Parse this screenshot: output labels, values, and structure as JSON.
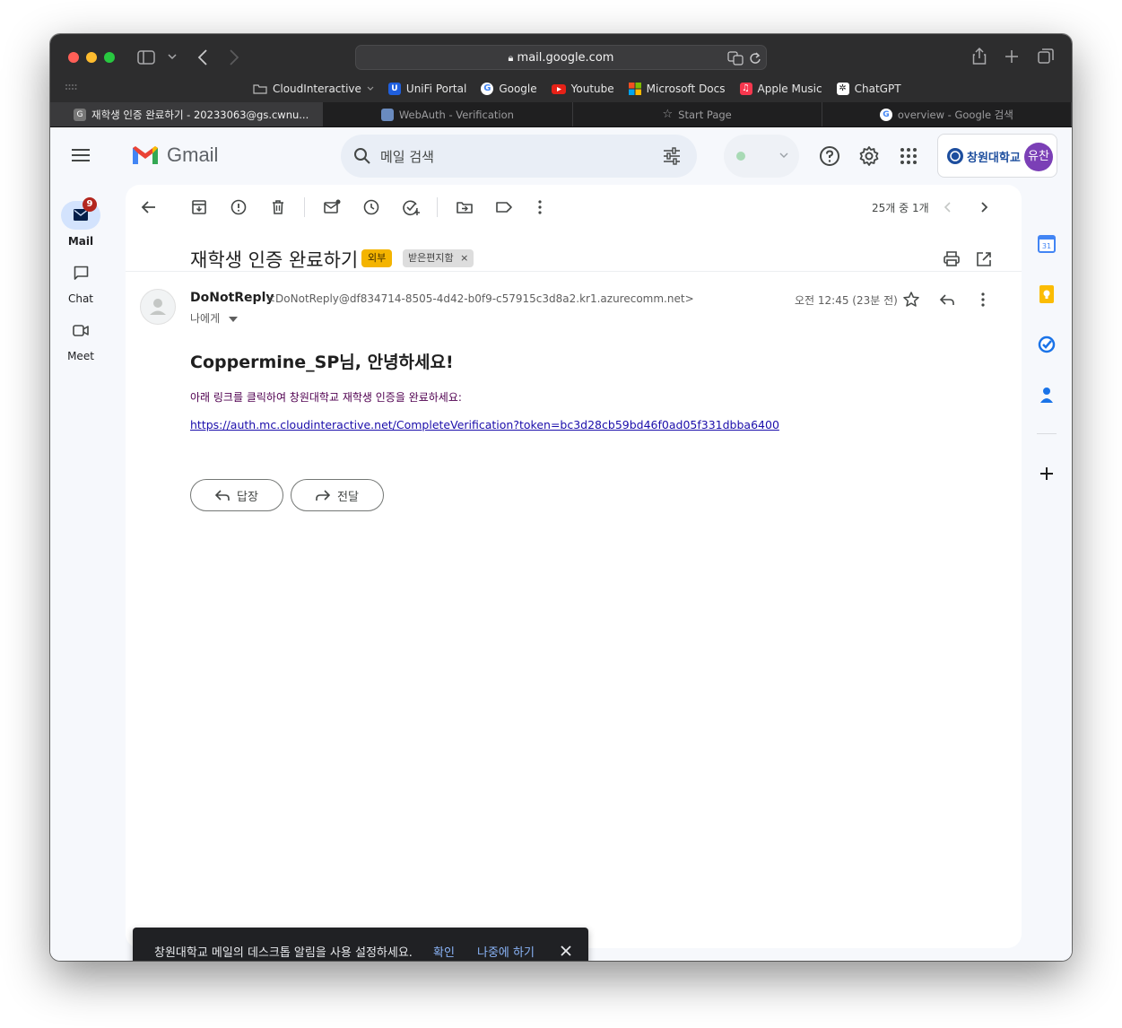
{
  "browser": {
    "url": "mail.google.com",
    "bookmarks": [
      {
        "label": "CloudInteractive",
        "icon": "folder-icon"
      },
      {
        "label": "UniFi Portal",
        "icon": "unifi-icon"
      },
      {
        "label": "Google",
        "icon": "google-icon"
      },
      {
        "label": "Youtube",
        "icon": "youtube-icon"
      },
      {
        "label": "Microsoft Docs",
        "icon": "microsoft-icon"
      },
      {
        "label": "Apple Music",
        "icon": "apple-music-icon"
      },
      {
        "label": "ChatGPT",
        "icon": "chatgpt-icon"
      }
    ],
    "tabs": [
      {
        "label": "재학생 인증 완료하기 - 20233063@gs.cwnu...",
        "active": true
      },
      {
        "label": "WebAuth - Verification",
        "active": false
      },
      {
        "label": "Start Page",
        "active": false
      },
      {
        "label": "overview - Google 검색",
        "active": false
      }
    ]
  },
  "gmail": {
    "brand": "Gmail",
    "search_placeholder": "메일 검색",
    "avatar_initials": "유찬",
    "org_logo_text": "창원대학교",
    "nav": [
      {
        "label": "Mail",
        "badge": "9"
      },
      {
        "label": "Chat"
      },
      {
        "label": "Meet"
      }
    ],
    "page_count": "25개 중 1개",
    "message": {
      "subject": "재학생 인증 완료하기",
      "label_external": "외부",
      "label_inbox": "받은편지함",
      "sender_name": "DoNotReply",
      "sender_email": "<DoNotReply@df834714-8505-4d42-b0f9-c57915c3d8a2.kr1.azurecomm.net>",
      "to": "나에게",
      "date": "오전 12:45 (23분 전)",
      "greeting": "Coppermine_SP님, 안녕하세요!",
      "instruction": "아래 링크를 클릭하여 창원대학교 재학생 인증을 완료하세요:",
      "link": "https://auth.mc.cloudinteractive.net/CompleteVerification?token=bc3d28cb59bd46f0ad05f331dbba6400",
      "reply_label": "답장",
      "forward_label": "전달"
    },
    "snackbar": {
      "text": "창원대학교 메일의 데스크톱 알림을 사용 설정하세요.",
      "confirm": "확인",
      "later": "나중에 하기"
    },
    "colors": {
      "accent": "#0b57d0",
      "badge": "#b3261e",
      "external_label": "#f4b400"
    }
  }
}
